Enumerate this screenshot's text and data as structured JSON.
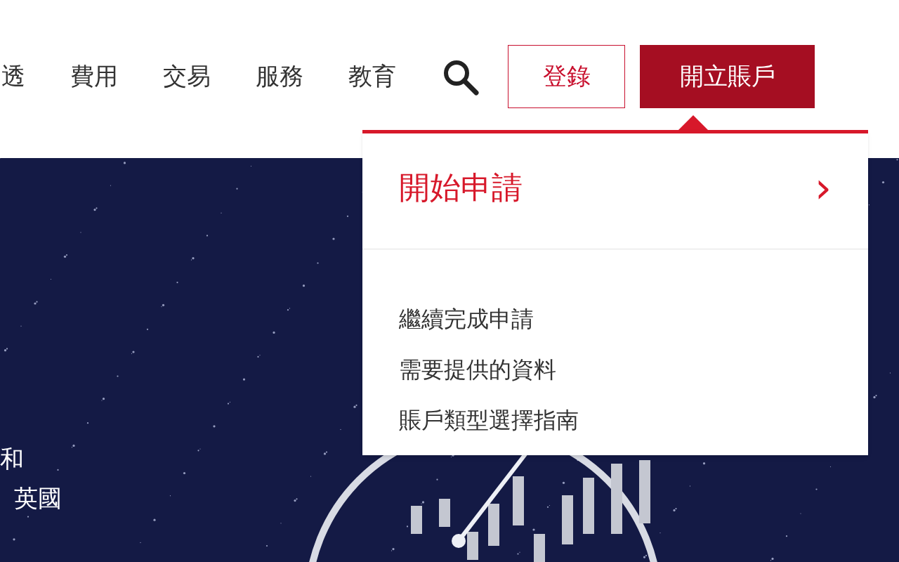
{
  "nav": {
    "items": [
      {
        "label": "透"
      },
      {
        "label": "費用"
      },
      {
        "label": "交易"
      },
      {
        "label": "服務"
      },
      {
        "label": "教育"
      }
    ],
    "login": "登錄",
    "open_account": {
      "label": "開立賬戶",
      "expanded": true
    }
  },
  "hero": {
    "lines": [
      "和",
      "英國"
    ]
  },
  "dropdown": {
    "primary": {
      "label": "開始申請",
      "icon": "›"
    },
    "links": [
      {
        "label": "繼續完成申請"
      },
      {
        "label": "需要提供的資料"
      },
      {
        "label": "賬戶類型選擇指南"
      }
    ]
  }
}
